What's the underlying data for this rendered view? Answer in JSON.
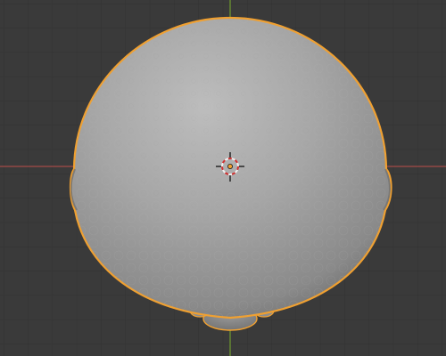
{
  "viewport": {
    "background_color": "#3a3a3a",
    "grid_color": "#333333",
    "x_axis_color": "#b94a48",
    "y_axis_color": "#6f9a2f",
    "selection_outline_color": "#f0a030",
    "object_color": "#9a9a9a"
  },
  "object": {
    "name": "sphere",
    "selected": true,
    "shading": "solid"
  },
  "origin": {
    "icon": "object-origin-icon",
    "color": "#f0a030"
  },
  "cursor": {
    "icon": "3d-cursor-icon",
    "ring_colors": [
      "#d03030",
      "#f0f0f0"
    ]
  }
}
